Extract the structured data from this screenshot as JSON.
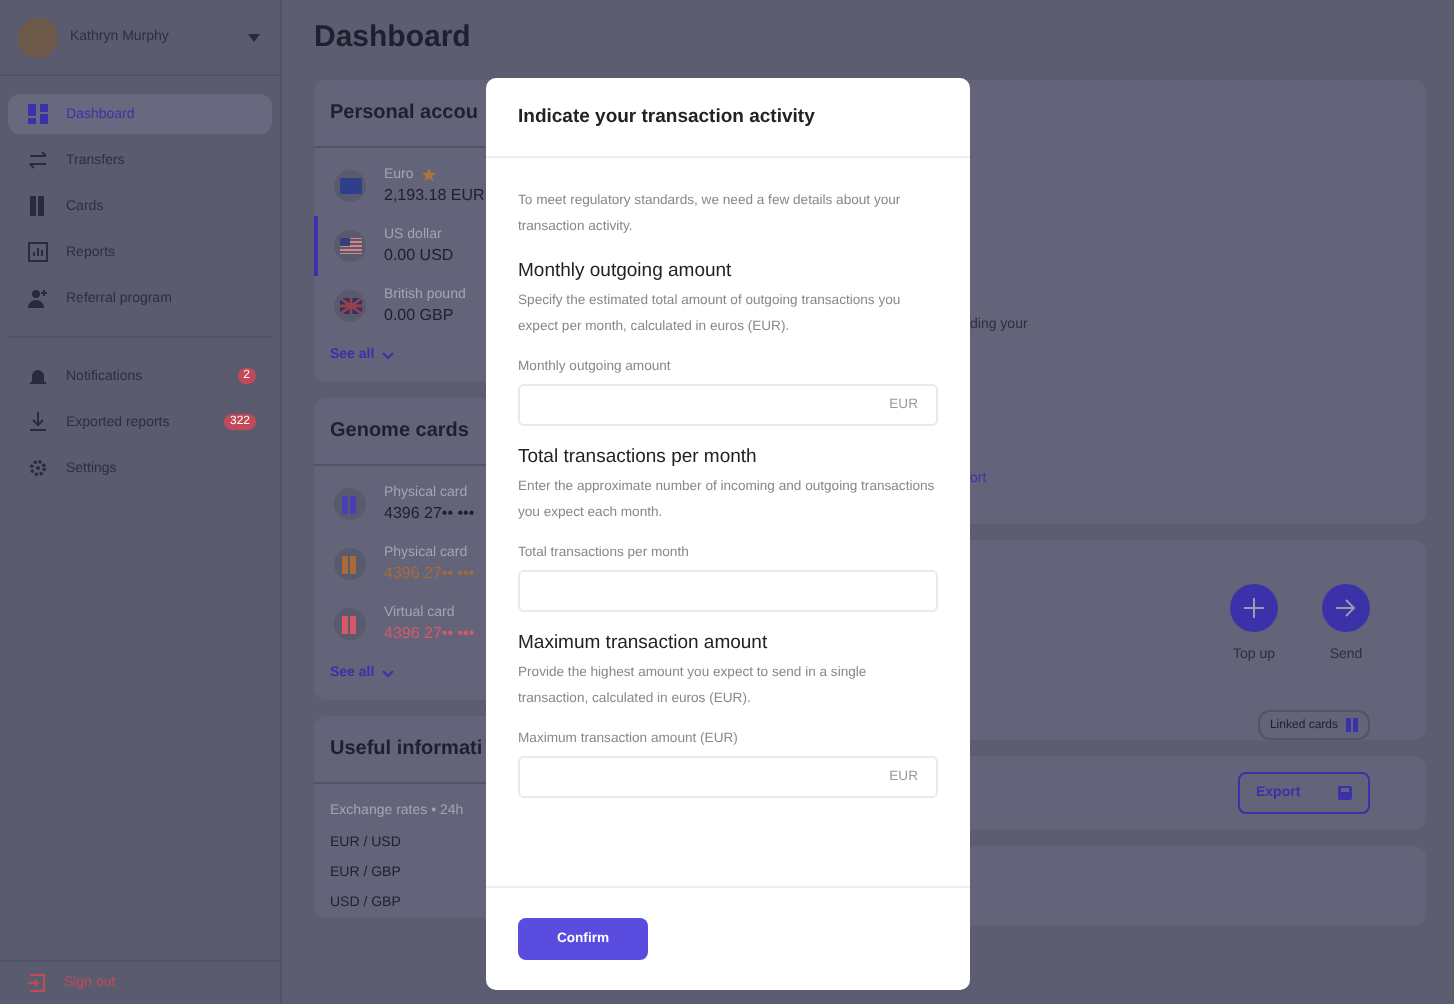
{
  "user": {
    "name": "Kathryn Murphy"
  },
  "sidebar": {
    "items": [
      {
        "label": "Dashboard",
        "selected": true
      },
      {
        "label": "Transfers",
        "selected": false
      },
      {
        "label": "Cards",
        "selected": false
      },
      {
        "label": "Reports",
        "selected": false
      },
      {
        "label": "Referral program",
        "selected": false
      }
    ],
    "secondary": [
      {
        "label": "Notifications",
        "badge": "2"
      },
      {
        "label": "Exported reports",
        "badge": "322"
      },
      {
        "label": "Settings"
      }
    ],
    "sign_out": "Sign out"
  },
  "page": {
    "title": "Dashboard"
  },
  "accounts": {
    "title": "Personal accou",
    "items": [
      {
        "name": "Euro",
        "favorite": true,
        "balance": "2,193.18 EUR",
        "selected": false
      },
      {
        "name": "US dollar",
        "favorite": false,
        "balance": "0.00 USD",
        "selected": true
      },
      {
        "name": "British pound",
        "favorite": false,
        "balance": "0.00 GBP",
        "selected": false
      }
    ],
    "see_all": "See all"
  },
  "genome_cards": {
    "title": "Genome cards",
    "items": [
      {
        "type": "Physical card",
        "number": "4396 27•• •••",
        "color": "#4a3fb0"
      },
      {
        "type": "Physical card",
        "number": "4396 27•• •••",
        "color": "#a86a3a"
      },
      {
        "type": "Virtual card",
        "number": "4396 27•• •••",
        "color": "#d85868"
      }
    ],
    "see_all": "See all"
  },
  "useful_info": {
    "title": "Useful informati",
    "subtitle": "Exchange rates • 24h",
    "pairs": [
      "EUR / USD",
      "EUR / GBP",
      "USD / GBP"
    ]
  },
  "right_panel": {
    "fragment": "ding your",
    "link": "ort",
    "actions": [
      {
        "label": "Top up"
      },
      {
        "label": "Send"
      }
    ],
    "linked_cards": "Linked cards",
    "export": "Export"
  },
  "modal": {
    "title": "Indicate your transaction activity",
    "intro": "To meet regulatory standards, we need a few details about your transaction activity.",
    "sections": [
      {
        "heading": "Monthly outgoing amount",
        "description": "Specify the estimated total amount of outgoing transactions you expect per month, calculated in euros (EUR).",
        "label": "Monthly outgoing amount",
        "suffix": "EUR"
      },
      {
        "heading": "Total transactions per month",
        "description": "Enter the approximate number of incoming and outgoing transactions you expect each month.",
        "label": "Total transactions per month"
      },
      {
        "heading": "Maximum transaction amount",
        "description": "Provide the highest amount you expect to send in a single transaction, calculated in euros (EUR).",
        "label": "Maximum transaction amount (EUR)",
        "suffix": "EUR"
      }
    ],
    "confirm": "Confirm"
  }
}
